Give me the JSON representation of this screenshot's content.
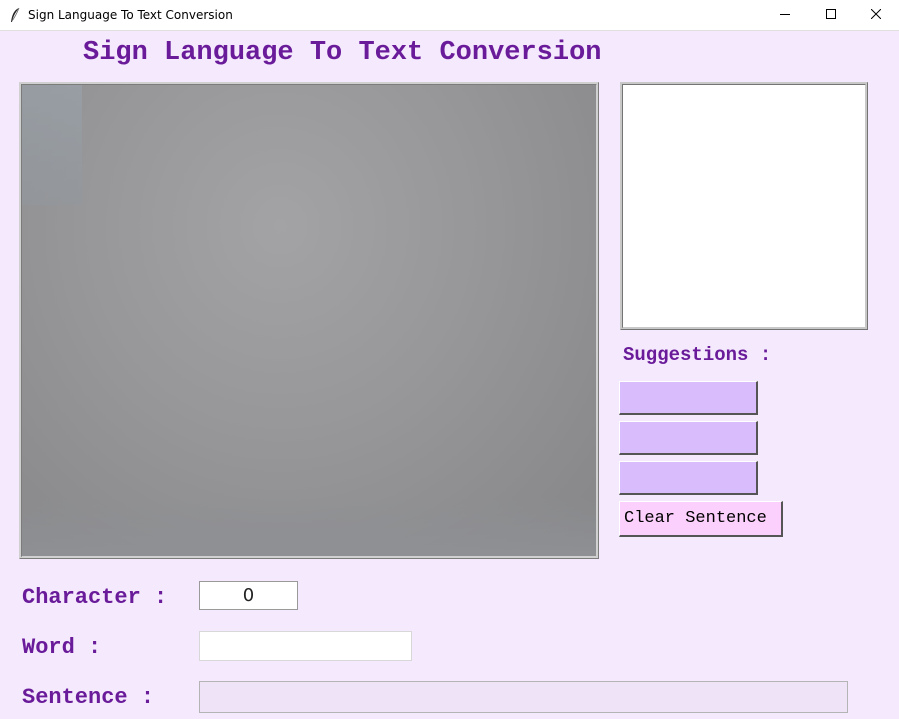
{
  "window": {
    "title": "Sign Language To Text Conversion",
    "icon": "feather-icon",
    "controls": [
      "minimize-icon",
      "maximize-icon",
      "close-icon"
    ]
  },
  "header": {
    "title": "Sign Language To Text Conversion"
  },
  "colors": {
    "background": "#f5eafd",
    "heading": "#6a1b9a",
    "suggestion_button": "#d8bcfc",
    "clear_button": "#fcd0fc"
  },
  "suggestions": {
    "label": "Suggestions :",
    "items": [
      "",
      "",
      ""
    ],
    "clear_label": "Clear Sentence"
  },
  "fields": {
    "character_label": "Character :",
    "character_value": "0",
    "word_label": "Word :",
    "word_value": "",
    "sentence_label": "Sentence :",
    "sentence_value": ""
  }
}
